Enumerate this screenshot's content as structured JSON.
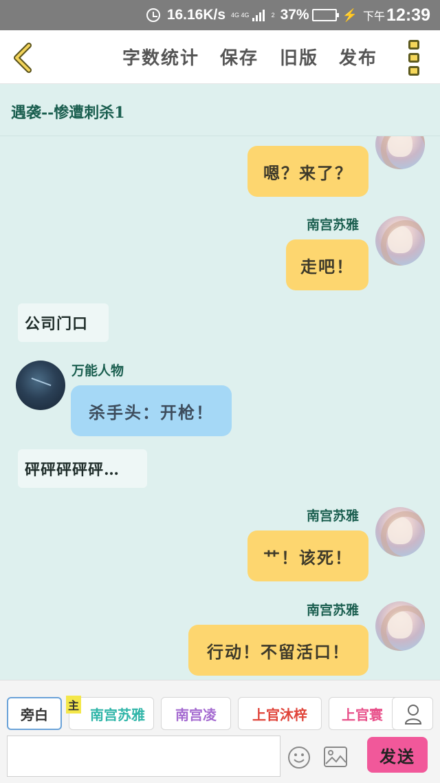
{
  "status_bar": {
    "net_speed": "16.16K/s",
    "network": "4G 4G",
    "sim": "2",
    "battery": "37%",
    "battery_level": 0.37,
    "ampm": "下午",
    "time": "12:39"
  },
  "toolbar": {
    "word_count": "字数统计",
    "save": "保存",
    "old_version": "旧版",
    "publish": "发布"
  },
  "doc_title": "遇袭--惨遭刺杀1",
  "messages": [
    {
      "type": "right",
      "speaker": "",
      "text": "嗯？来了？"
    },
    {
      "type": "right",
      "speaker": "南宫苏雅",
      "text": "走吧！"
    },
    {
      "type": "narration",
      "text": "公司门口"
    },
    {
      "type": "left",
      "speaker": "万能人物",
      "text": "杀手头：开枪！"
    },
    {
      "type": "narration",
      "text": "砰砰砰砰砰…"
    },
    {
      "type": "right",
      "speaker": "南宫苏雅",
      "text": "艹！该死！"
    },
    {
      "type": "right",
      "speaker": "南宫苏雅",
      "text": "行动！不留活口！"
    }
  ],
  "characters": {
    "main_tag": "主",
    "items": [
      {
        "label": "旁白",
        "color": "#333333",
        "selected": true
      },
      {
        "label": "南宫苏雅",
        "color": "#2fb5a8",
        "selected": false
      },
      {
        "label": "南宫凌",
        "color": "#a46ad0",
        "selected": false
      },
      {
        "label": "上官沐梓",
        "color": "#e0443a",
        "selected": false
      },
      {
        "label": "上官寰",
        "color": "#e8508a",
        "selected": false
      }
    ]
  },
  "input": {
    "value": "",
    "placeholder": ""
  },
  "send_label": "发送",
  "accent": {
    "yellow_bubble": "#fdd66f",
    "blue_bubble": "#a5d8f6",
    "send": "#f1589a",
    "background": "#def0ee"
  }
}
